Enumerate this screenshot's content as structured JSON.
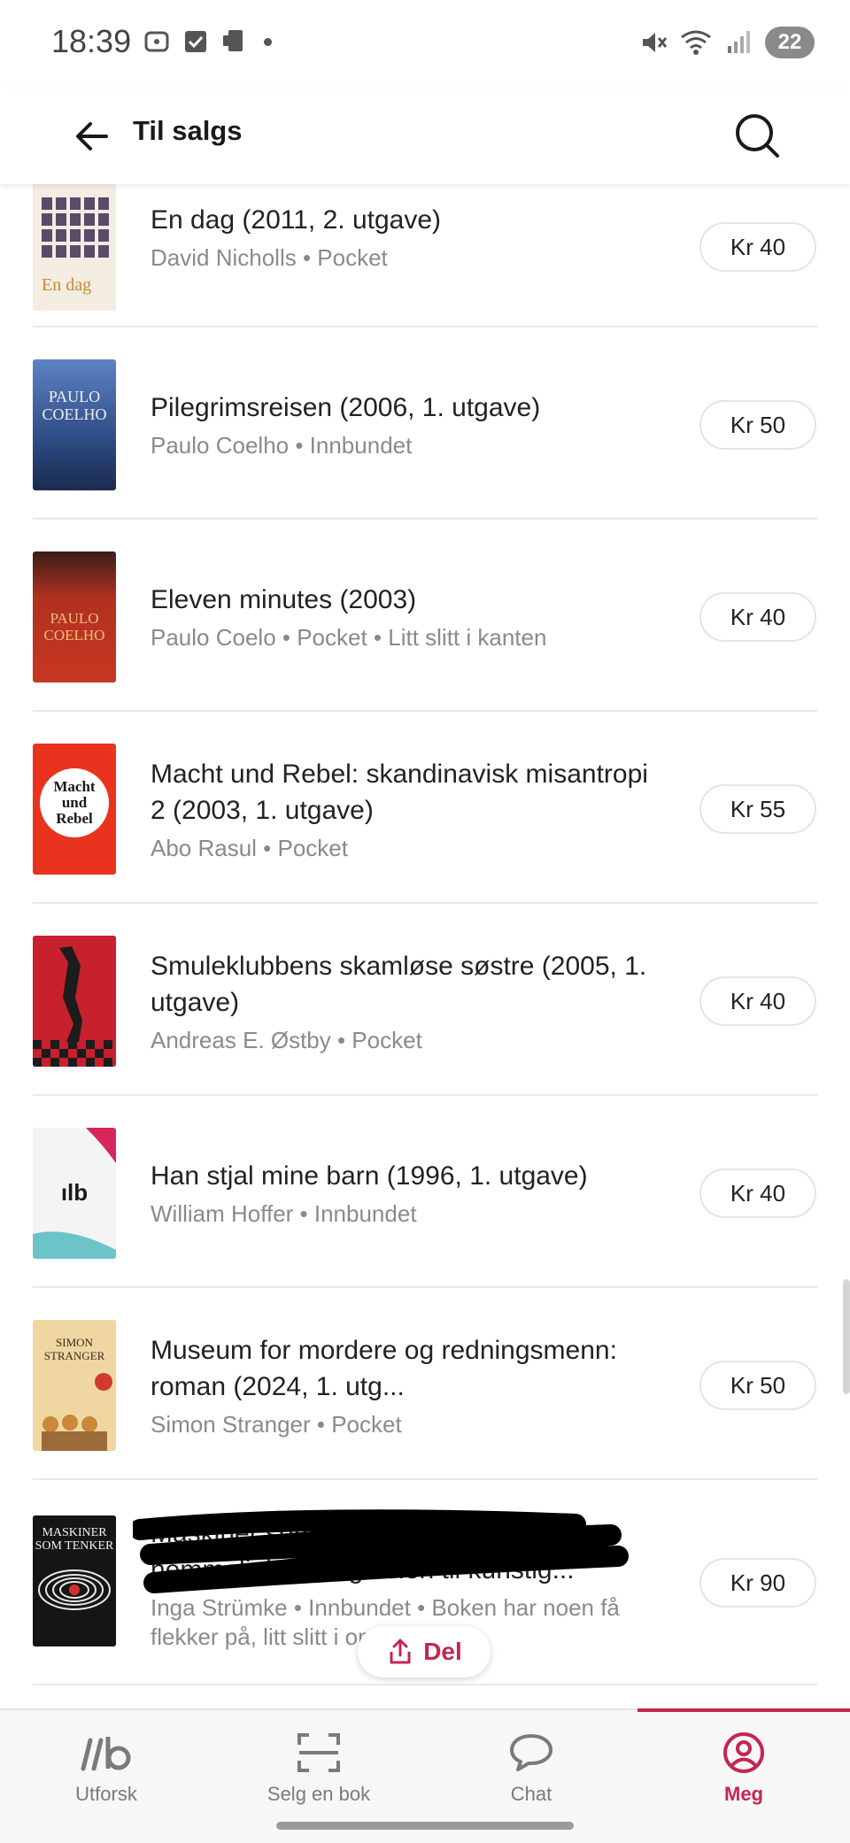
{
  "status_bar": {
    "time": "18:39",
    "battery": "22"
  },
  "header": {
    "title": "Til salgs"
  },
  "items": [
    {
      "title": "En dag (2011, 2. utgave)",
      "meta": "David Nicholls • Pocket",
      "price": "Kr 40",
      "cover_text": "En dag"
    },
    {
      "title": "Pilegrimsreisen (2006, 1. utgave)",
      "meta": "Paulo Coelho • Innbundet",
      "price": "Kr 50",
      "cover_text": "PAULO COELHO"
    },
    {
      "title": "Eleven minutes (2003)",
      "meta": "Paulo Coelo • Pocket • Litt slitt i kanten",
      "price": "Kr 40",
      "cover_text": "PAULO COELHO"
    },
    {
      "title": "Macht und Rebel: skandinavisk misantropi 2 (2003, 1. utgave)",
      "meta": "Abo Rasul • Pocket",
      "price": "Kr 55",
      "cover_text": "Macht und Rebel"
    },
    {
      "title": "Smuleklubbens skamløse søstre (2005, 1. utgave)",
      "meta": "Andreas E. Østby • Pocket",
      "price": "Kr 40",
      "cover_text": ""
    },
    {
      "title": "Han stjal mine barn (1996, 1. utgave)",
      "meta": "William Hoffer • Innbundet",
      "price": "Kr 40",
      "cover_text": "ılb"
    },
    {
      "title": "Museum for mordere og redningsmenn: roman (2024, 1. utg...",
      "meta": "Simon Stranger • Pocket",
      "price": "Kr 50",
      "cover_text": "SIMON STRANGER"
    },
    {
      "title": "Maskiner som tenker: algoritmenes hemmeligheter og veien til kunstig...",
      "meta": "Inga Strümke • Innbundet • Boken har noen få flekker på, litt slitt i omsl...",
      "price": "Kr 90",
      "cover_text": "MASKINER SOM TENKER"
    }
  ],
  "share": {
    "label": "Del"
  },
  "nav": [
    {
      "label": "Utforsk"
    },
    {
      "label": "Selg en bok"
    },
    {
      "label": "Chat"
    },
    {
      "label": "Meg"
    }
  ],
  "colors": {
    "accent": "#c4264f"
  }
}
